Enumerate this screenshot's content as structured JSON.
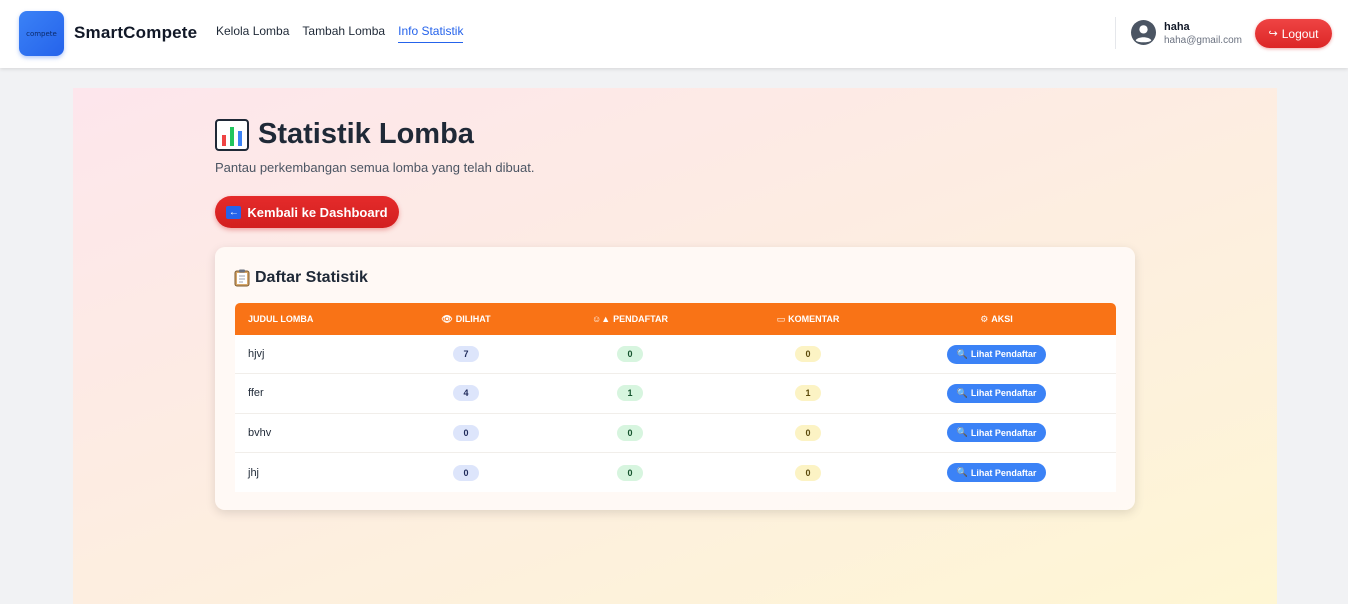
{
  "header": {
    "brand": "SmartCompete",
    "logo_text": "compete",
    "nav": [
      {
        "label": "Kelola Lomba",
        "active": false
      },
      {
        "label": "Tambah Lomba",
        "active": false
      },
      {
        "label": "Info Statistik",
        "active": true
      }
    ],
    "user": {
      "name": "haha",
      "email": "haha@gmail.com"
    },
    "logout_label": "Logout"
  },
  "page": {
    "title": "Statistik Lomba",
    "subtitle": "Pantau perkembangan semua lomba yang telah dibuat.",
    "back_label": "Kembali ke Dashboard"
  },
  "card": {
    "title": "Daftar Statistik",
    "columns": {
      "title": "JUDUL LOMBA",
      "views": "DILIHAT",
      "registrants": "PENDAFTAR",
      "comments": "KOMENTAR",
      "action": "AKSI"
    },
    "rows": [
      {
        "title": "hjvj",
        "views": "7",
        "registrants": "0",
        "comments": "0",
        "action": "Lihat Pendaftar"
      },
      {
        "title": "ffer",
        "views": "4",
        "registrants": "1",
        "comments": "1",
        "action": "Lihat Pendaftar"
      },
      {
        "title": "bvhv",
        "views": "0",
        "registrants": "0",
        "comments": "0",
        "action": "Lihat Pendaftar"
      },
      {
        "title": "jhj",
        "views": "0",
        "registrants": "0",
        "comments": "0",
        "action": "Lihat Pendaftar"
      }
    ]
  },
  "colors": {
    "accent_orange": "#f97316",
    "logout_red": "#dc2626",
    "link_blue": "#2563eb",
    "action_blue": "#3b82f6"
  },
  "icons": {
    "title": "bar-chart-icon",
    "back": "back-arrow-icon",
    "card": "clipboard-icon",
    "views": "eye-icon",
    "registrants": "person-graduation-icon",
    "comments": "speech-bubble-icon",
    "action": "gear-icon",
    "row_action": "magnifier-icon",
    "user": "user-circle-icon",
    "logout": "logout-icon"
  }
}
